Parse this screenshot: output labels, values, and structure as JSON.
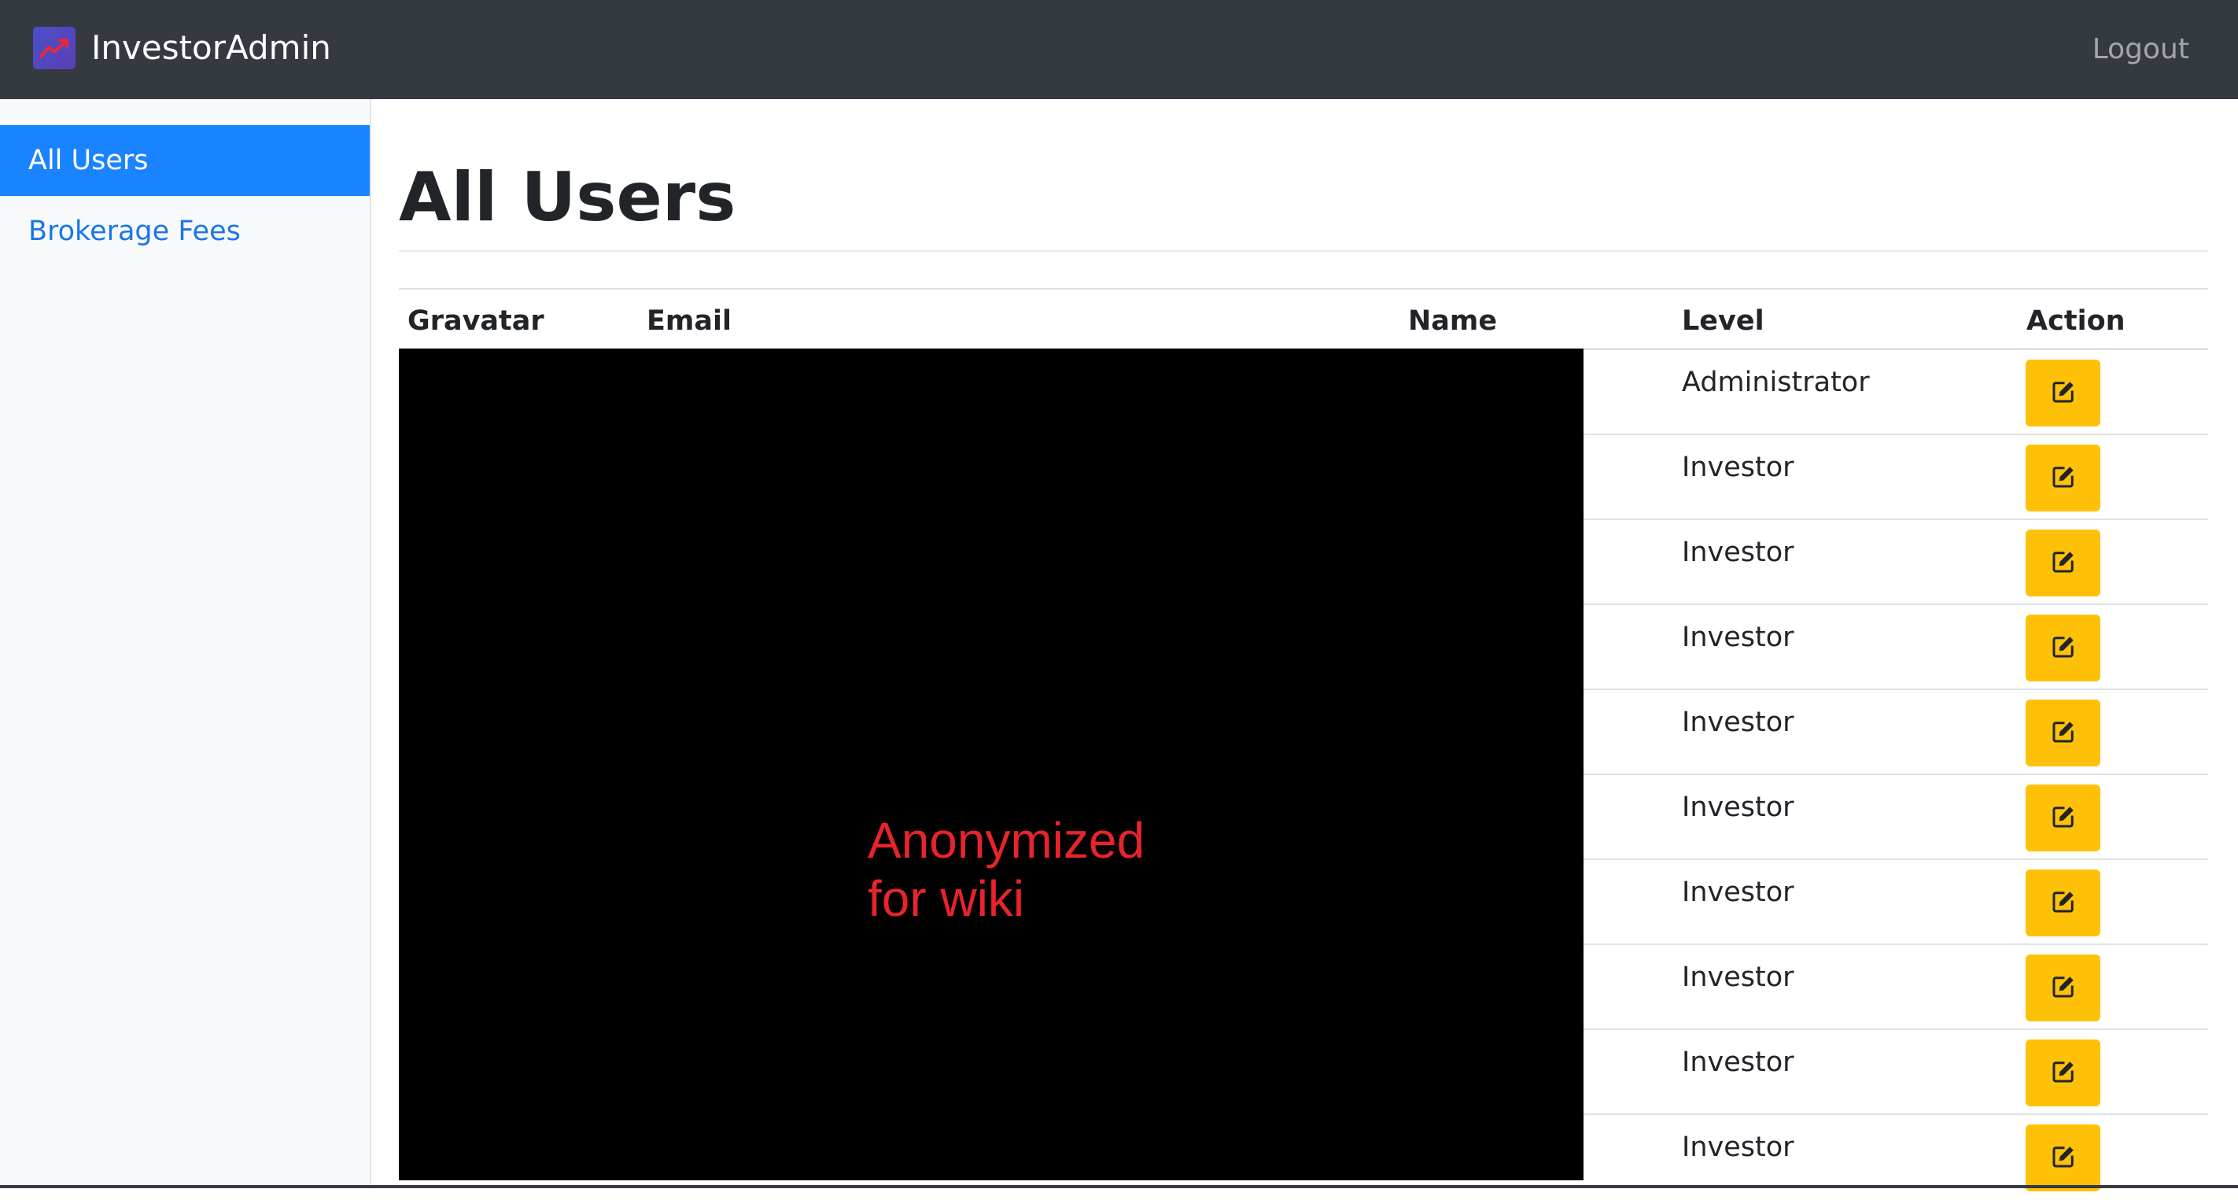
{
  "navbar": {
    "brand": "InvestorAdmin",
    "logo_icon": "trending-chart-icon",
    "logout_label": "Logout"
  },
  "sidebar": {
    "items": [
      {
        "label": "All Users",
        "active": true
      },
      {
        "label": "Brokerage Fees",
        "active": false
      }
    ]
  },
  "main": {
    "title": "All Users",
    "table": {
      "headers": [
        "Gravatar",
        "Email",
        "Name",
        "Level",
        "Action"
      ],
      "rows": [
        {
          "level": "Administrator",
          "action_icon": "edit-icon"
        },
        {
          "level": "Investor",
          "action_icon": "edit-icon"
        },
        {
          "level": "Investor",
          "action_icon": "edit-icon"
        },
        {
          "level": "Investor",
          "action_icon": "edit-icon"
        },
        {
          "level": "Investor",
          "action_icon": "edit-icon"
        },
        {
          "level": "Investor",
          "action_icon": "edit-icon"
        },
        {
          "level": "Investor",
          "action_icon": "edit-icon"
        },
        {
          "level": "Investor",
          "action_icon": "edit-icon"
        },
        {
          "level": "Investor",
          "action_icon": "edit-icon"
        },
        {
          "level": "Investor",
          "action_icon": "edit-icon"
        }
      ]
    },
    "redaction": {
      "text_line1": "Anonymized",
      "text_line2": "for wiki"
    }
  },
  "colors": {
    "navbar_bg": "#343a40",
    "active_nav": "#1a83ff",
    "link": "#1a76e8",
    "edit_button": "#ffc107",
    "redaction_text": "#e8232b"
  }
}
